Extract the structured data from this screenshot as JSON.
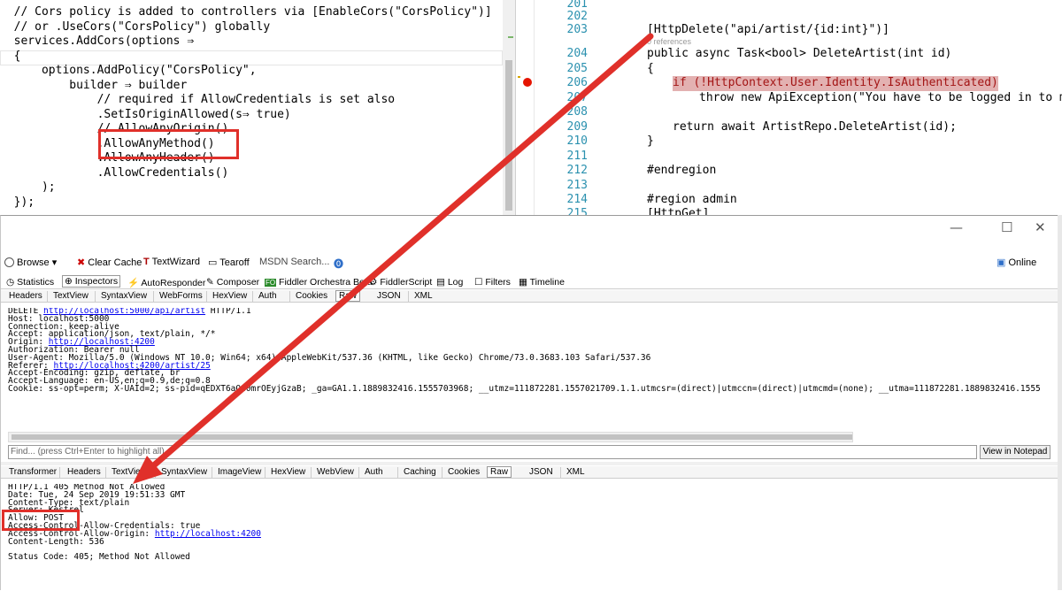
{
  "left_code": {
    "lines": [
      "  // Cors policy is added to controllers via [EnableCors(\"CorsPolicy\")]",
      "  // or .UseCors(\"CorsPolicy\") globally",
      "  services.AddCors(options ⇒",
      "  {",
      "      options.AddPolicy(\"CorsPolicy\",",
      "          builder ⇒ builder",
      "              // required if AllowCredentials is set also",
      "              .SetIsOriginAllowed(s⇒ true)",
      "              //.AllowAnyOrigin()",
      "              .AllowAnyMethod()",
      "              .AllowAnyHeader()",
      "              .AllowCredentials()",
      "      );",
      "  });"
    ]
  },
  "right_code": {
    "line_numbers": [
      "201",
      "202",
      "203",
      "204",
      "205",
      "206",
      "207",
      "208",
      "209",
      "210",
      "211",
      "212",
      "213",
      "214",
      "215"
    ],
    "references": "0 references",
    "lines": {
      "l203": "[HttpDelete(\"api/artist/{id:int}\")]",
      "l204": "public async Task<bool> DeleteArtist(int id)",
      "l205": "{",
      "l206": "if (!HttpContext.User.Identity.IsAuthenticated)",
      "l207": "throw new ApiException(\"You have to be logged in to mod",
      "l209": "return await ArtistRepo.DeleteArtist(id);",
      "l210": "}",
      "l212": "#endregion",
      "l214": "#region admin",
      "l215": "[HttpGet]"
    }
  },
  "window_controls": {
    "minimize": "—",
    "maximize": "☐",
    "close": "✕"
  },
  "toolbar": {
    "browse": "Browse",
    "clear_cache": "Clear Cache",
    "text_wizard": "TextWizard",
    "tearoff": "Tearoff",
    "msdn_search": "MSDN Search...",
    "online": "Online"
  },
  "main_tabs": [
    "Statistics",
    "Inspectors",
    "AutoResponder",
    "Composer",
    "Fiddler Orchestra Beta",
    "FiddlerScript",
    "Log",
    "Filters",
    "Timeline"
  ],
  "request_tabs": [
    "Headers",
    "TextView",
    "SyntaxView",
    "WebForms",
    "HexView",
    "Auth",
    "Cookies",
    "Raw",
    "JSON",
    "XML"
  ],
  "request": {
    "line1_method": "DELETE ",
    "line1_url": "http://localhost:5000/api/artist",
    "line1_proto": " HTTP/1.1",
    "host": "Host: localhost:5000",
    "connection": "Connection: keep-alive",
    "accept": "Accept: application/json, text/plain, */*",
    "origin_label": "Origin: ",
    "origin_url": "http://localhost:4200",
    "authorization": "Authorization: Bearer null",
    "user_agent": "User-Agent: Mozilla/5.0 (Windows NT 10.0; Win64; x64) AppleWebKit/537.36 (KHTML, like Gecko) Chrome/73.0.3683.103 Safari/537.36",
    "referer_label": "Referer: ",
    "referer_url": "http://localhost:4200/artist/25",
    "accept_encoding": "Accept-Encoding: gzip, deflate, br",
    "accept_language": "Accept-Language: en-US,en;q=0.9,de;q=0.8",
    "cookie": "Cookie: ss-opt=perm; X-UAId=2; ss-pid=qEDXT6aQw0mrOEyjGzaB; _ga=GA1.1.1889832416.1555703968; __utmz=111872281.1557021709.1.1.utmcsr=(direct)|utmccn=(direct)|utmcmd=(none); __utma=111872281.1889832416.1555"
  },
  "find_placeholder": "Find... (press Ctrl+Enter to highlight all)",
  "view_in_notepad": "View in Notepad",
  "response_tabs": [
    "Transformer",
    "Headers",
    "TextView",
    "SyntaxView",
    "ImageView",
    "HexView",
    "WebView",
    "Auth",
    "Caching",
    "Cookies",
    "Raw",
    "JSON",
    "XML"
  ],
  "response": {
    "status_line": "HTTP/1.1 405 Method Not Allowed",
    "date": "Date: Tue, 24 Sep 2019 19:51:33 GMT",
    "content_type": "Content-Type: text/plain",
    "server": "Server: Kestrel",
    "allow": "Allow: POST",
    "allow_credentials": "Access-Control-Allow-Credentials: true",
    "allow_origin_label": "Access-Control-Allow-Origin: ",
    "allow_origin_url": "http://localhost:4200",
    "content_length": "Content-Length: 536",
    "status_code": "Status Code: 405; Method Not Allowed"
  },
  "colors": {
    "annotation_red": "#e0302a",
    "link_blue": "#0000ee"
  }
}
